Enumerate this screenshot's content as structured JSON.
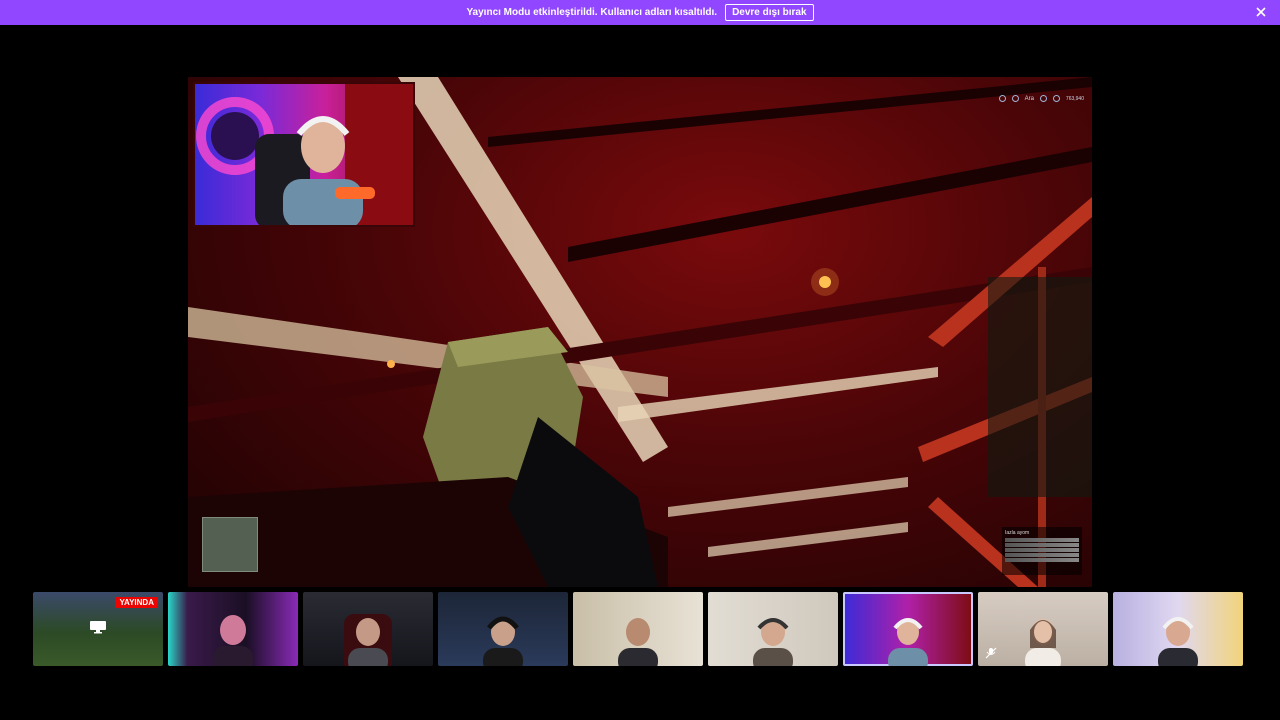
{
  "banner": {
    "message": "Yayıncı Modu etkinleştirildi. Kullanıcı adları kısaltıldı.",
    "button_label": "Devre dışı bırak"
  },
  "hud": {
    "label": "Ara",
    "value": "763,940"
  },
  "stats_panel": {
    "title": "Iazla ayom"
  },
  "thumbnails": [
    {
      "id": "t1",
      "live_label": "YAYINDA",
      "has_screen_icon": true,
      "bg": "#2c4a25"
    },
    {
      "id": "t2",
      "bg": "#3a1a4a"
    },
    {
      "id": "t3",
      "bg": "#22232a"
    },
    {
      "id": "t4",
      "bg": "#1d2638"
    },
    {
      "id": "t5",
      "bg": "#cfc6b4"
    },
    {
      "id": "t6",
      "bg": "#d8d3cb"
    },
    {
      "id": "t7",
      "bg": "#8a1a8f",
      "selected": true
    },
    {
      "id": "t8",
      "bg": "#d7ccc2",
      "muted": true
    },
    {
      "id": "t9",
      "bg": "#c7c0e8"
    }
  ],
  "colors": {
    "accent": "#9147ff",
    "live": "#eb0400"
  }
}
